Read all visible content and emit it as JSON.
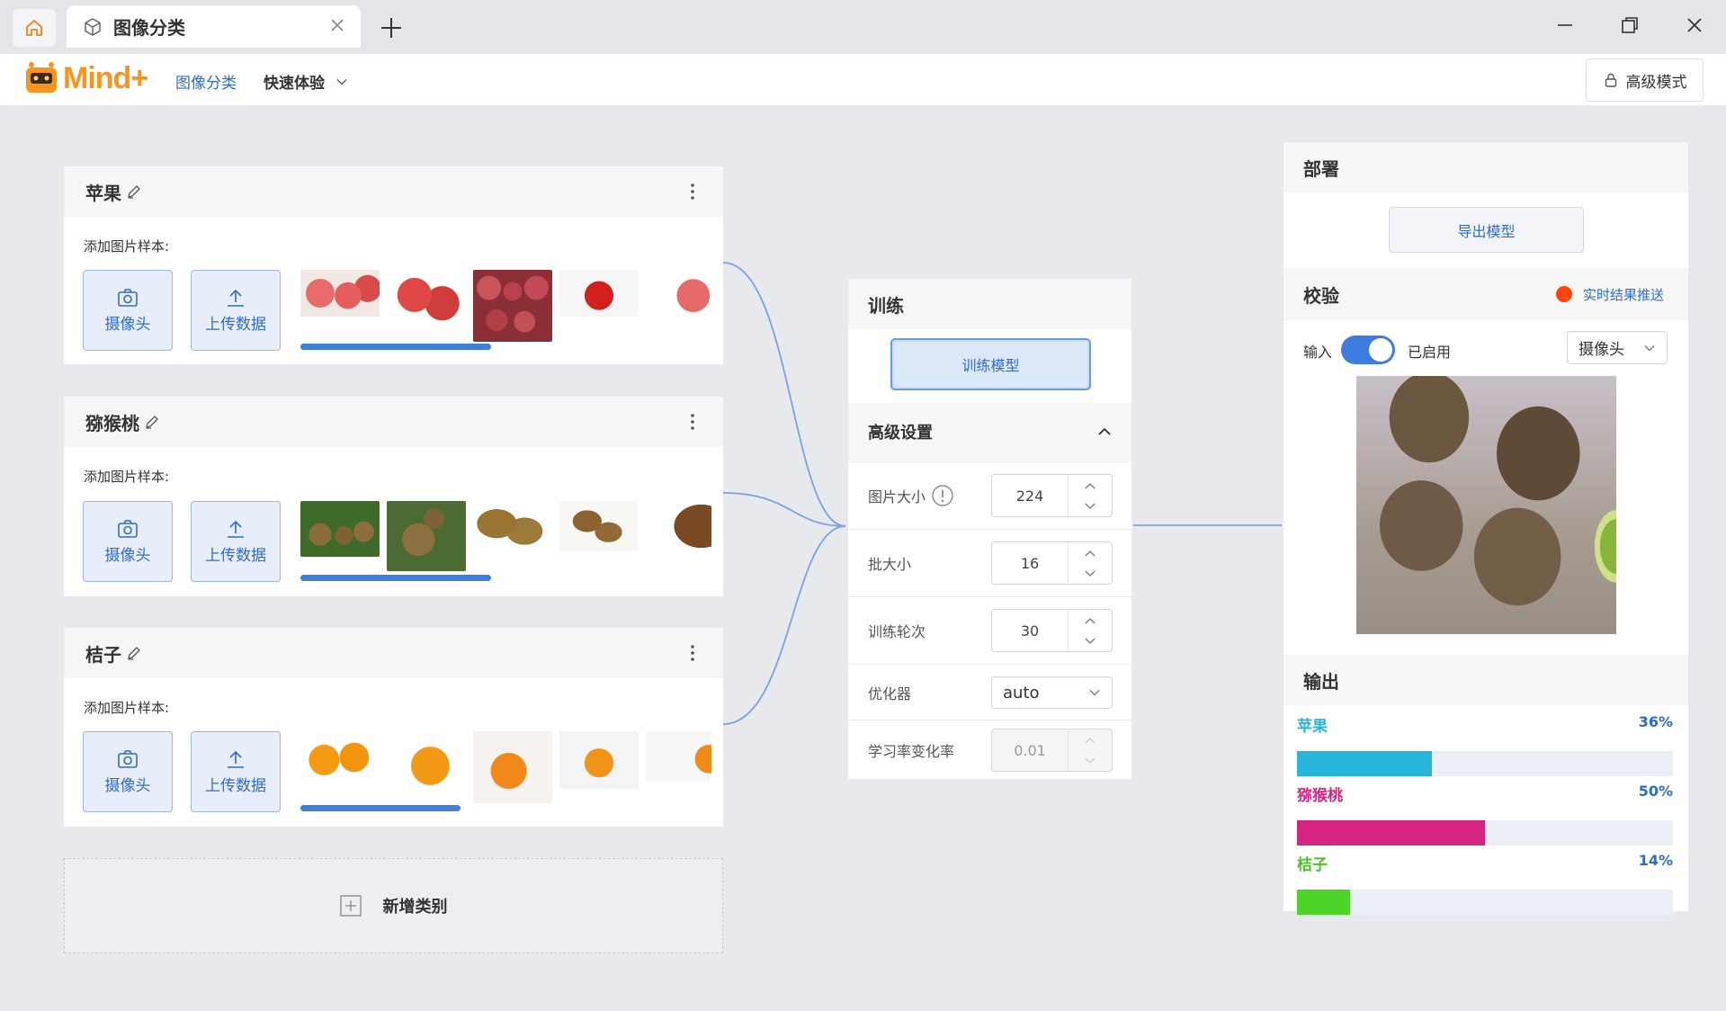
{
  "window": {
    "tab_title": "图像分类"
  },
  "nav": {
    "logo_text": "Mind+",
    "image_class": "图像分类",
    "quick_try": "快速体验",
    "advanced_mode": "高级模式"
  },
  "classes": [
    {
      "name": "苹果",
      "sample_label": "添加图片样本:",
      "camera": "摄像头",
      "upload": "上传数据"
    },
    {
      "name": "猕猴桃",
      "sample_label": "添加图片样本:",
      "camera": "摄像头",
      "upload": "上传数据"
    },
    {
      "name": "桔子",
      "sample_label": "添加图片样本:",
      "camera": "摄像头",
      "upload": "上传数据"
    }
  ],
  "add_class": "新增类别",
  "train": {
    "title": "训练",
    "button": "训练模型",
    "advanced": "高级设置",
    "params": {
      "image_size": {
        "label": "图片大小",
        "value": "224"
      },
      "batch_size": {
        "label": "批大小",
        "value": "16"
      },
      "epochs": {
        "label": "训练轮次",
        "value": "30"
      },
      "optimizer": {
        "label": "优化器",
        "value": "auto"
      },
      "lr": {
        "label": "学习率变化率",
        "value": "0.01"
      }
    }
  },
  "deploy": {
    "title": "部署",
    "export": "导出模型"
  },
  "verify": {
    "title": "校验",
    "realtime": "实时结果推送",
    "input_label": "输入",
    "enabled": "已启用",
    "source": "摄像头"
  },
  "output": {
    "title": "输出",
    "items": [
      {
        "label": "苹果",
        "percent": "36%",
        "value": 0.36,
        "color": "#27b6d9"
      },
      {
        "label": "猕猴桃",
        "percent": "50%",
        "value": 0.5,
        "color": "#d6247f"
      },
      {
        "label": "桔子",
        "percent": "14%",
        "value": 0.14,
        "color": "#4cd426"
      }
    ]
  },
  "colors": {
    "accent": "#3f7fdc",
    "brand": "#f7941d",
    "record": "#ff4410"
  }
}
